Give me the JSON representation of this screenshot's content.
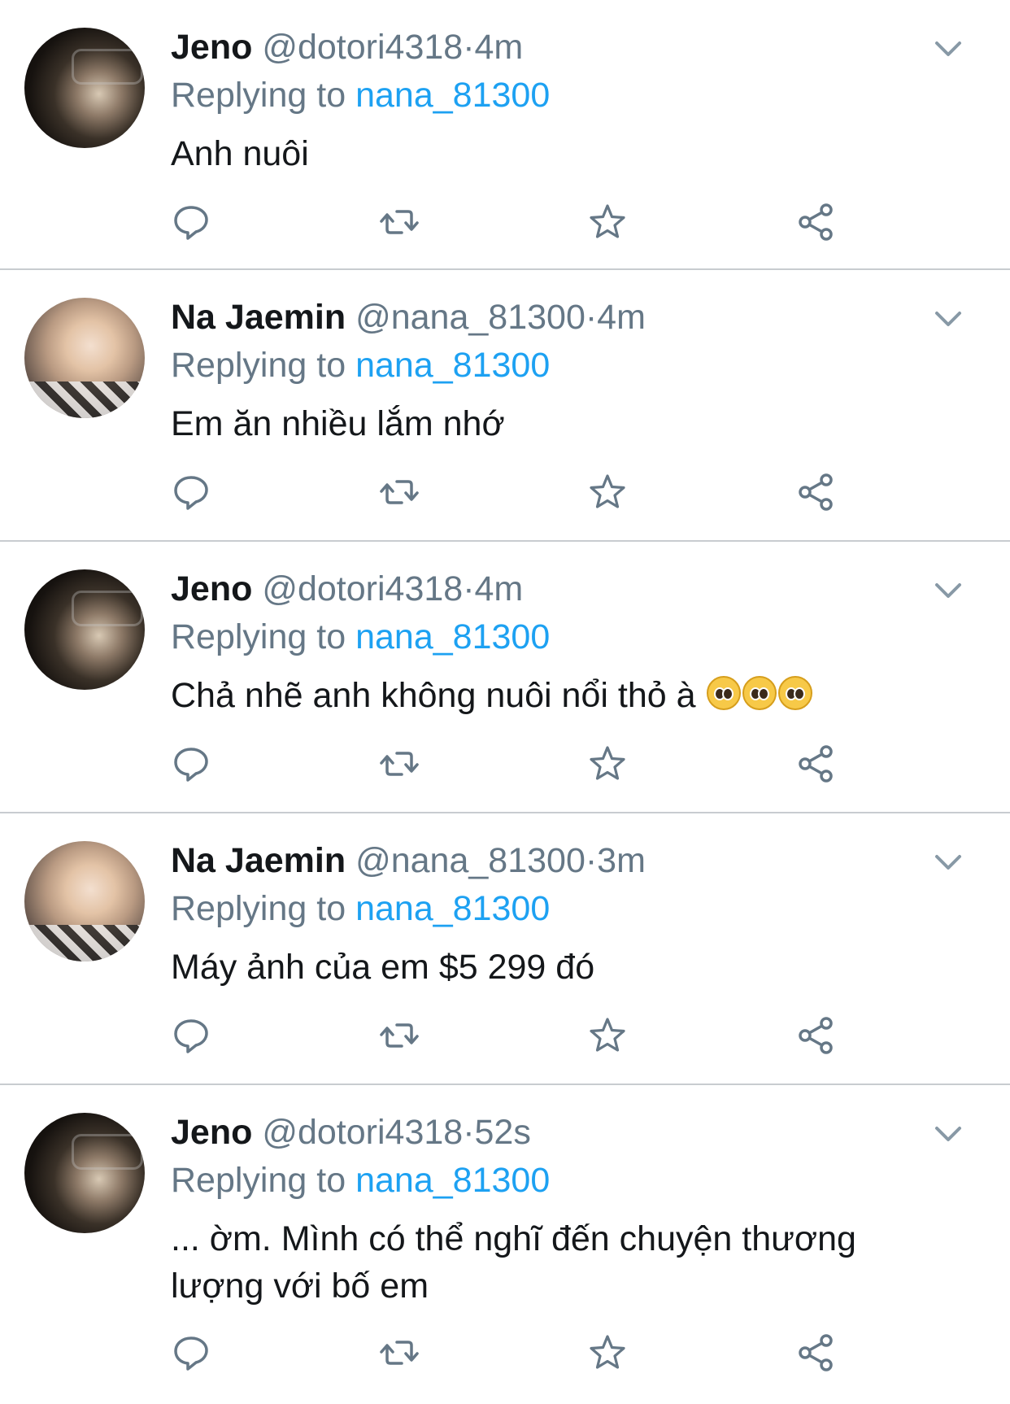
{
  "tweets": [
    {
      "name": "Jeno",
      "handle": "@dotori4318",
      "time": "·4m",
      "reply_prefix": "Replying to",
      "reply_to": "nana_81300",
      "text": "Anh nuôi",
      "emoji_count": 0,
      "avatar": "jeno-avatar"
    },
    {
      "name": "Na Jaemin",
      "handle": "@nana_81300",
      "time": "·4m",
      "reply_prefix": "Replying to",
      "reply_to": "nana_81300",
      "text": "Em ăn nhiều lắm nhớ",
      "emoji_count": 0,
      "avatar": "jaemin-avatar"
    },
    {
      "name": "Jeno",
      "handle": "@dotori4318",
      "time": "·4m",
      "reply_prefix": "Replying to",
      "reply_to": "nana_81300",
      "text": "Chả nhẽ anh không nuôi nổi thỏ à",
      "emoji_count": 3,
      "emoji_name": "pleading-face-emoji",
      "avatar": "jeno-avatar"
    },
    {
      "name": "Na Jaemin",
      "handle": "@nana_81300",
      "time": "·3m",
      "reply_prefix": "Replying to",
      "reply_to": "nana_81300",
      "text": "Máy ảnh của em $5 299 đó",
      "emoji_count": 0,
      "avatar": "jaemin-avatar"
    },
    {
      "name": "Jeno",
      "handle": "@dotori4318",
      "time": "·52s",
      "reply_prefix": "Replying to",
      "reply_to": "nana_81300",
      "text": "... ờm. Mình có thể nghĩ đến chuyện thương lượng với bố em",
      "emoji_count": 0,
      "avatar": "jeno-avatar"
    }
  ],
  "icons": {
    "more": "chevron-down-icon",
    "reply": "reply-icon",
    "retweet": "retweet-icon",
    "like": "star-icon",
    "share": "share-icon"
  },
  "colors": {
    "link": "#1da1f2",
    "secondary": "#657786",
    "divider": "#c8ccd0",
    "text": "#14171a"
  }
}
